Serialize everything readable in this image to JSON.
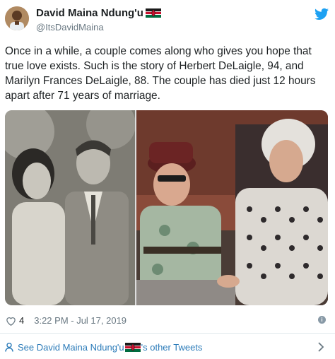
{
  "author": {
    "display_name": "David Maina Ndung'u",
    "handle": "@ItsDavidMaina",
    "flag": "kenya-flag-emoji"
  },
  "tweet": {
    "text": "Once in a while, a couple comes along who gives you hope that true love exists. Such is the story of Herbert DeLaigle, 94, and Marilyn Frances DeLaigle, 88. The couple has died just 12 hours apart after 71 years of marriage.",
    "likes": "4",
    "timestamp": "3:22 PM - Jul 17, 2019"
  },
  "footer": {
    "link_prefix": "See David Maina Ndung'u",
    "link_suffix": "'s other Tweets"
  },
  "colors": {
    "text": "#1c2022",
    "muted": "#697882",
    "link": "#2b7bb9",
    "twitter_blue": "#1da1f2",
    "divider": "#e1e8ed"
  },
  "icons": [
    "avatar",
    "kenya-flag-icon",
    "twitter-bird-icon",
    "heart-icon",
    "info-icon",
    "person-icon",
    "chevron-right-icon"
  ]
}
